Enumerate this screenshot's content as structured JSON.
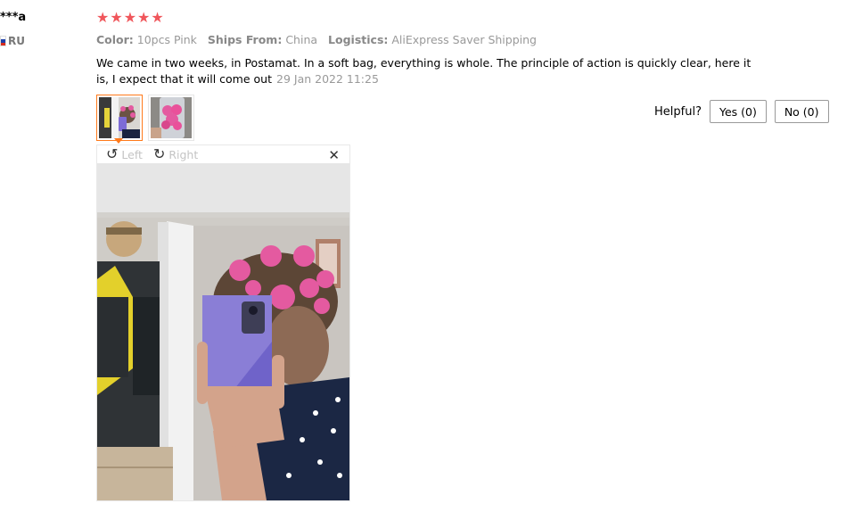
{
  "reviewer": {
    "name": "***a",
    "country": "RU"
  },
  "rating": {
    "stars": 5,
    "max": 5
  },
  "meta": [
    {
      "key": "Color:",
      "value": "10pcs Pink"
    },
    {
      "key": "Ships From:",
      "value": "China"
    },
    {
      "key": "Logistics:",
      "value": "AliExpress Saver Shipping"
    }
  ],
  "review": {
    "text": "We came in two weeks, in Postamat. In a soft bag, everything is whole. The principle of action is quickly clear, here it is, I expect that it will come out",
    "date": "29 Jan 2022 11:25"
  },
  "helpful": {
    "label": "Helpful?",
    "yes": "Yes (0)",
    "no": "No (0)"
  },
  "viewer": {
    "left_label": "Left",
    "right_label": "Right",
    "close_icon": "close-icon"
  },
  "colors": {
    "star": "#f0565b",
    "active_border": "#ff7a1b",
    "curler_pink": "#e45aa0"
  }
}
